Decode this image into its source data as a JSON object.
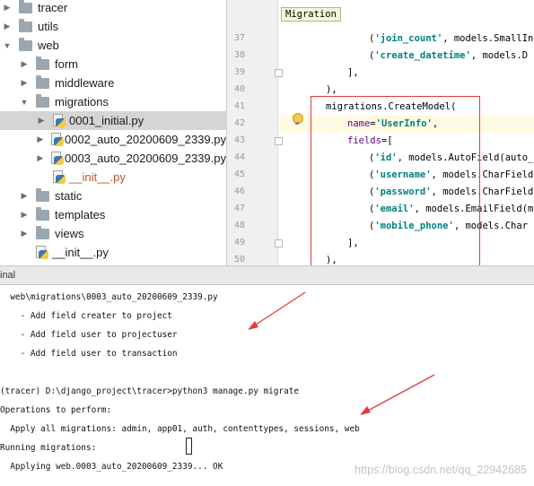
{
  "tree": {
    "items": [
      {
        "label": "tracer",
        "type": "folder",
        "expanded": false,
        "indent": 0
      },
      {
        "label": "utils",
        "type": "folder",
        "expanded": false,
        "indent": 0
      },
      {
        "label": "web",
        "type": "folder",
        "expanded": true,
        "indent": 0
      },
      {
        "label": "form",
        "type": "folder",
        "expanded": false,
        "indent": 1
      },
      {
        "label": "middleware",
        "type": "folder",
        "expanded": false,
        "indent": 1
      },
      {
        "label": "migrations",
        "type": "folder",
        "expanded": true,
        "indent": 1
      },
      {
        "label": "0001_initial.py",
        "type": "py",
        "selected": true,
        "indent": 2
      },
      {
        "label": "0002_auto_20200609_2339.py",
        "type": "py",
        "indent": 2
      },
      {
        "label": "0003_auto_20200609_2339.py",
        "type": "py",
        "indent": 2
      },
      {
        "label": "__init__.py",
        "type": "py",
        "red": true,
        "indent": 2
      },
      {
        "label": "static",
        "type": "folder",
        "expanded": false,
        "indent": 1
      },
      {
        "label": "templates",
        "type": "folder",
        "expanded": false,
        "indent": 1
      },
      {
        "label": "views",
        "type": "folder",
        "expanded": false,
        "indent": 1
      },
      {
        "label": "__init__.py",
        "type": "py",
        "indent": 1
      }
    ]
  },
  "editor": {
    "tooltip": "Migration",
    "line_numbers": [
      "37",
      "38",
      "39",
      "40",
      "41",
      "42",
      "43",
      "44",
      "45",
      "46",
      "47",
      "48",
      "49",
      "50"
    ],
    "lines": [
      {
        "text": "('join_count', models.SmallIn"
      },
      {
        "text": "('create_datetime', models.D"
      },
      {
        "text": "],"
      },
      {
        "text": "),"
      },
      {
        "text": "migrations.CreateModel("
      },
      {
        "text": "name='UserInfo',"
      },
      {
        "text": "fields=["
      },
      {
        "text": "('id', models.AutoField(auto_c"
      },
      {
        "text": "('username', models.CharField"
      },
      {
        "text": "('password', models.CharField"
      },
      {
        "text": "('email', models.EmailField(m"
      },
      {
        "text": "('mobile_phone', models.Char"
      },
      {
        "text": "],"
      },
      {
        "text": "),"
      }
    ]
  },
  "terminal": {
    "header": "inal",
    "lines": [
      "  web\\migrations\\0003_auto_20200609_2339.py",
      "    - Add field creater to project",
      "    - Add field user to projectuser",
      "    - Add field user to transaction",
      "",
      "(tracer) D:\\django_project\\tracer>python3 manage.py migrate",
      "Operations to perform:",
      "  Apply all migrations: admin, app01, auth, contenttypes, sessions, web",
      "Running migrations:",
      "  Applying web.0003_auto_20200609_2339... OK"
    ],
    "watermark": "https://blog.csdn.net/qq_22942685"
  },
  "colors": {
    "annotation_red": "#e03c3c",
    "selection_gray": "#d5d5d5",
    "string_teal": "#008080",
    "keyword_purple": "#660099"
  }
}
